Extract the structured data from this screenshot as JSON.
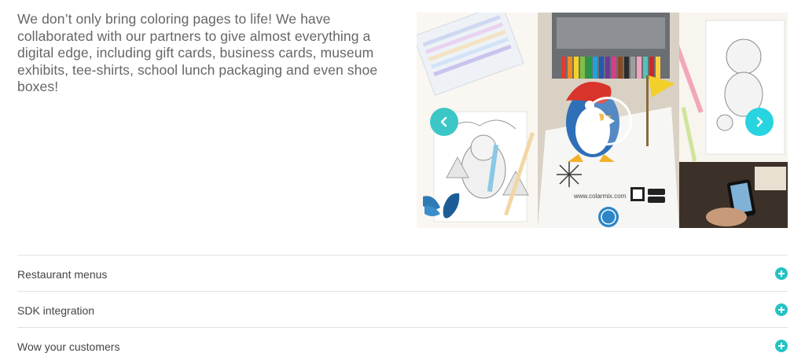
{
  "intro": {
    "text": "We don’t only bring coloring pages to life! We have collaborated with our partners to give almost everything a digital edge, including gift cards, business cards, museum exhibits, tee-shirts, school lunch packaging and even shoe boxes!"
  },
  "carousel": {
    "prev_icon": "chevron-left-icon",
    "next_icon": "chevron-right-icon",
    "play_icon": "play-icon",
    "website_text": "www.colarmix.com",
    "accent_color": "#3cc7c6"
  },
  "accordion": {
    "items": [
      {
        "label": "Restaurant menus",
        "icon": "plus-icon"
      },
      {
        "label": "SDK integration",
        "icon": "plus-icon"
      },
      {
        "label": "Wow your customers",
        "icon": "plus-icon"
      }
    ]
  }
}
